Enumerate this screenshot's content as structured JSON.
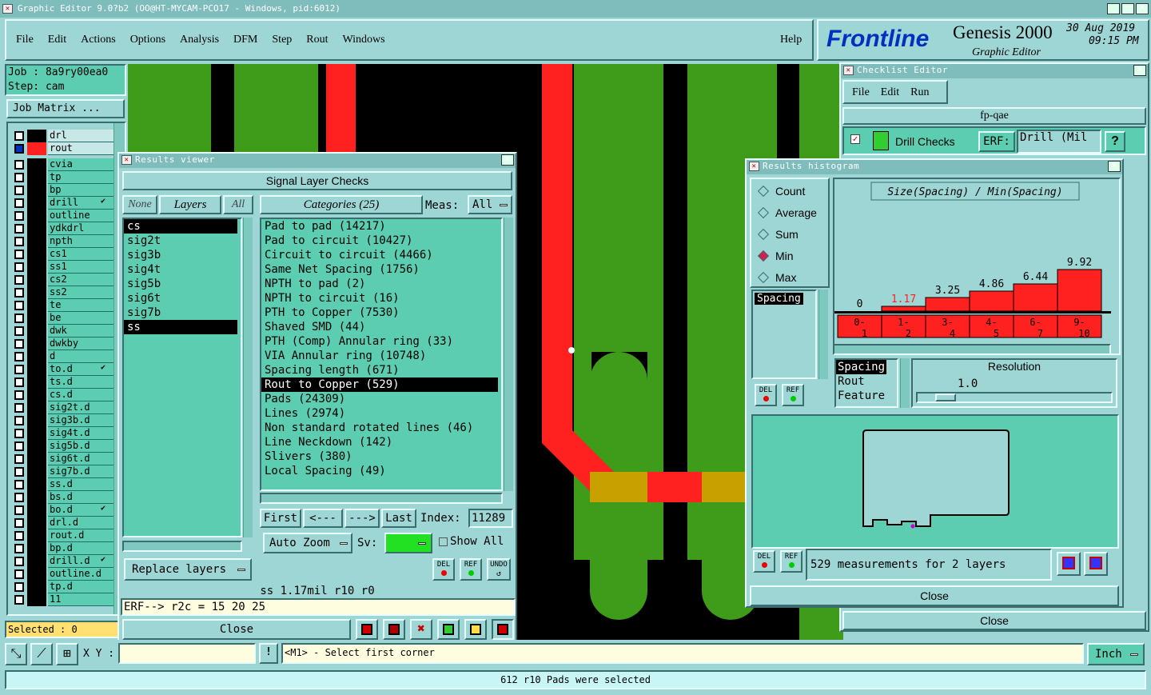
{
  "title_bar": {
    "text": "Graphic Editor 9.0?b2 (OO@HT-MYCAM-PCO17 - Windows, pid:6012)"
  },
  "menu": [
    "File",
    "Edit",
    "Actions",
    "Options",
    "Analysis",
    "DFM",
    "Step",
    "Rout",
    "Windows"
  ],
  "help": "Help",
  "brand": {
    "logo": "Frontline",
    "product": "Genesis 2000",
    "subtitle": "Graphic Editor",
    "date": "30 Aug 2019",
    "time": "09:15 PM"
  },
  "job": {
    "job": "Job : 8a9ry00ea0",
    "step": "Step: cam",
    "matrix_button": "Job Matrix ..."
  },
  "layers": [
    {
      "name": "drl",
      "swatch": "#000000"
    },
    {
      "name": "rout",
      "swatch": "#ff2020"
    },
    {
      "name": "cvia"
    },
    {
      "name": "tp"
    },
    {
      "name": "bp"
    },
    {
      "name": "drill",
      "mark": "✔"
    },
    {
      "name": "outline"
    },
    {
      "name": "ydkdrl"
    },
    {
      "name": "npth"
    },
    {
      "name": "cs1"
    },
    {
      "name": "ss1"
    },
    {
      "name": "cs2"
    },
    {
      "name": "ss2"
    },
    {
      "name": "te"
    },
    {
      "name": "be"
    },
    {
      "name": "dwk"
    },
    {
      "name": "dwkby"
    },
    {
      "name": "d"
    },
    {
      "name": "to.d",
      "mark": "✔"
    },
    {
      "name": "ts.d"
    },
    {
      "name": "cs.d"
    },
    {
      "name": "sig2t.d"
    },
    {
      "name": "sig3b.d"
    },
    {
      "name": "sig4t.d"
    },
    {
      "name": "sig5b.d"
    },
    {
      "name": "sig6t.d"
    },
    {
      "name": "sig7b.d"
    },
    {
      "name": "ss.d"
    },
    {
      "name": "bs.d"
    },
    {
      "name": "bo.d",
      "mark": "✔"
    },
    {
      "name": "drl.d"
    },
    {
      "name": "rout.d"
    },
    {
      "name": "bp.d"
    },
    {
      "name": "drill.d",
      "mark": "✔"
    },
    {
      "name": "outline.d"
    },
    {
      "name": "tp.d"
    },
    {
      "name": "11"
    }
  ],
  "selected_count": "Selected : 0",
  "results_viewer": {
    "title": "Results viewer",
    "header": "Signal Layer Checks",
    "none": "None",
    "layers_label": "Layers",
    "all": "All",
    "layer_list": [
      "cs",
      "sig2t",
      "sig3b",
      "sig4t",
      "sig5b",
      "sig6t",
      "sig7b",
      "ss"
    ],
    "categories_label": "Categories (25)",
    "meas_label": "Meas:",
    "meas_value": "All",
    "categories": [
      "Pad to pad (14217)",
      "Pad to circuit (10427)",
      "Circuit to circuit (4466)",
      "Same Net Spacing (1756)",
      "NPTH to pad (2)",
      "NPTH to circuit (16)",
      "PTH to Copper (7530)",
      "Shaved SMD (44)",
      "PTH (Comp) Annular ring (33)",
      "VIA Annular ring (10748)",
      "Spacing length (671)",
      "Rout to Copper (529)",
      "Pads (24309)",
      "Lines (2974)",
      "Non standard rotated lines (46)",
      "Line Neckdown (142)",
      "Slivers (380)",
      "Local Spacing (49)"
    ],
    "selected_category": "Rout to Copper (529)",
    "first": "First",
    "prev": "<---",
    "next": "--->",
    "last": "Last",
    "index_label": "Index:",
    "index_value": "11289",
    "auto_zoom": "Auto Zoom",
    "sv_label": "Sv:",
    "show_all": "Show All",
    "replace_layers": "Replace layers",
    "del": "DEL",
    "ref": "REF",
    "undo": "UNDO",
    "status_line": "ss 1.17mil   r10   r0",
    "erf_line": "ERF--> r2c = 15 20 25",
    "close": "Close"
  },
  "checklist_editor": {
    "title": "Checklist Editor",
    "menu": [
      "File",
      "Edit",
      "Run"
    ],
    "name": "fp-qae",
    "row_label": "Drill Checks",
    "erf_label": "ERF:",
    "erf_value": "Drill (Mil",
    "help": "?",
    "close": "Close"
  },
  "histogram": {
    "title": "Results histogram",
    "modes": [
      "Count",
      "Average",
      "Sum",
      "Min",
      "Max"
    ],
    "selected_mode": "Min",
    "chart_title": "Size(Spacing) / Min(Spacing)",
    "list_items": [
      "Spacing"
    ],
    "del": "DEL",
    "ref": "REF",
    "sort_items": [
      "Spacing",
      "Rout",
      "Feature"
    ],
    "resolution_label": "Resolution",
    "resolution_value": "1.0",
    "summary": "529 measurements for 2 layers",
    "close": "Close"
  },
  "chart_data": {
    "type": "bar",
    "title": "Size(Spacing) / Min(Spacing)",
    "categories": [
      "0-1",
      "1-2",
      "3-4",
      "4-5",
      "6-7",
      "9-10"
    ],
    "values": [
      0,
      1.17,
      3.25,
      4.86,
      6.44,
      9.92
    ],
    "value_labels": [
      "0",
      "1.17",
      "3.25",
      "4.86",
      "6.44",
      "9.92"
    ],
    "colors": {
      "bar": "#ff2020",
      "highlight_label": "#ff2020"
    }
  },
  "bottom": {
    "xy_label": "X Y :",
    "prompt": "<M1> - Select first corner",
    "units": "Inch",
    "status": "612 r10 Pads were selected"
  },
  "colors": {
    "panel": "#9ed6d6",
    "list": "#5ccdb0",
    "copper_green": "#3f9b1a",
    "rout_red": "#ff2020",
    "overlap": "#c8a000"
  }
}
